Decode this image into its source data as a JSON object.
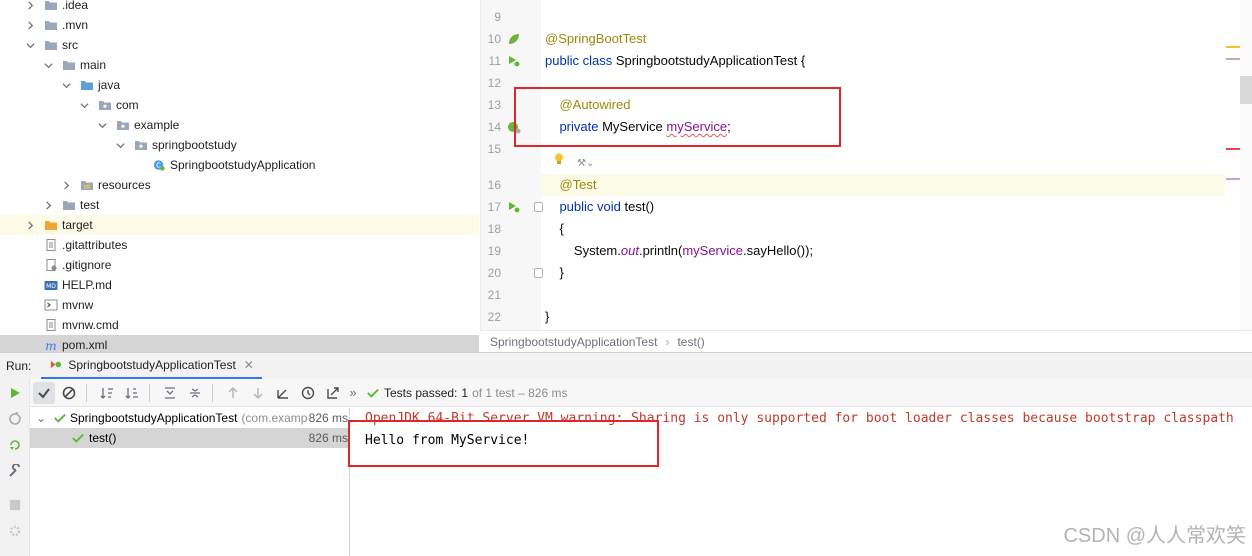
{
  "project_tree": {
    "rows": [
      {
        "label": ".idea",
        "icon": "folder-icon",
        "expanded": false
      },
      {
        "label": ".mvn",
        "icon": "folder-icon",
        "expanded": false
      },
      {
        "label": "src",
        "icon": "folder-icon",
        "expanded": true
      },
      {
        "label": "main",
        "icon": "folder-icon",
        "expanded": true
      },
      {
        "label": "java",
        "icon": "source-folder-icon",
        "expanded": true
      },
      {
        "label": "com",
        "icon": "package-icon",
        "expanded": true
      },
      {
        "label": "example",
        "icon": "package-icon",
        "expanded": true
      },
      {
        "label": "springbootstudy",
        "icon": "package-icon",
        "expanded": true
      },
      {
        "label": "SpringbootstudyApplication",
        "icon": "spring-class-icon"
      },
      {
        "label": "resources",
        "icon": "resources-folder-icon",
        "expanded": false
      },
      {
        "label": "test",
        "icon": "folder-icon",
        "expanded": false
      },
      {
        "label": "target",
        "icon": "excluded-folder-icon",
        "expanded": false
      },
      {
        "label": ".gitattributes",
        "icon": "text-file-icon"
      },
      {
        "label": ".gitignore",
        "icon": "gitignore-file-icon"
      },
      {
        "label": "HELP.md",
        "icon": "markdown-file-icon"
      },
      {
        "label": "mvnw",
        "icon": "script-file-icon"
      },
      {
        "label": "mvnw.cmd",
        "icon": "text-file-icon"
      },
      {
        "label": "pom.xml",
        "icon": "maven-file-icon"
      }
    ]
  },
  "editor": {
    "line_numbers": [
      "9",
      "10",
      "11",
      "12",
      "13",
      "14",
      "15",
      "",
      "16",
      "17",
      "18",
      "19",
      "20",
      "21",
      "22"
    ],
    "code": {
      "l10": "@SpringBootTest",
      "l11_kw": "public class",
      "l11_rest": " SpringbootstudyApplicationTest {",
      "l13": "@Autowired",
      "l14_kw": "private",
      "l14_type": " MyService ",
      "l14_field": "myService",
      "l14_end": ";",
      "l16": "@Test",
      "l17_kw": "public void",
      "l17_rest": " test()",
      "l18": "{",
      "l19_a": "System.",
      "l19_out": "out",
      "l19_b": ".println(",
      "l19_field": "myService",
      "l19_c": ".sayHello());",
      "l20": "}",
      "l22": "}"
    },
    "breadcrumbs": [
      "SpringbootstudyApplicationTest",
      "test()"
    ]
  },
  "run_window": {
    "label": "Run:",
    "tab_title": "SpringbootstudyApplicationTest",
    "status_main": "Tests passed:",
    "status_count": "1",
    "status_rest": "of 1 test – 826 ms",
    "results": [
      {
        "name": "SpringbootstudyApplicationTest",
        "detail": "(com.examp",
        "time": "826 ms"
      },
      {
        "name": "test()",
        "time": "826 ms"
      }
    ],
    "console": [
      "OpenJDK 64-Bit Server VM warning: Sharing is only supported for boot loader classes because bootstrap classpath",
      "Hello from MyService!"
    ]
  },
  "watermark": "CSDN @人人常欢笑",
  "colors": {
    "accent": "#3574f0",
    "pass_green": "#5fb832",
    "annotation_box": "#e0262b"
  }
}
